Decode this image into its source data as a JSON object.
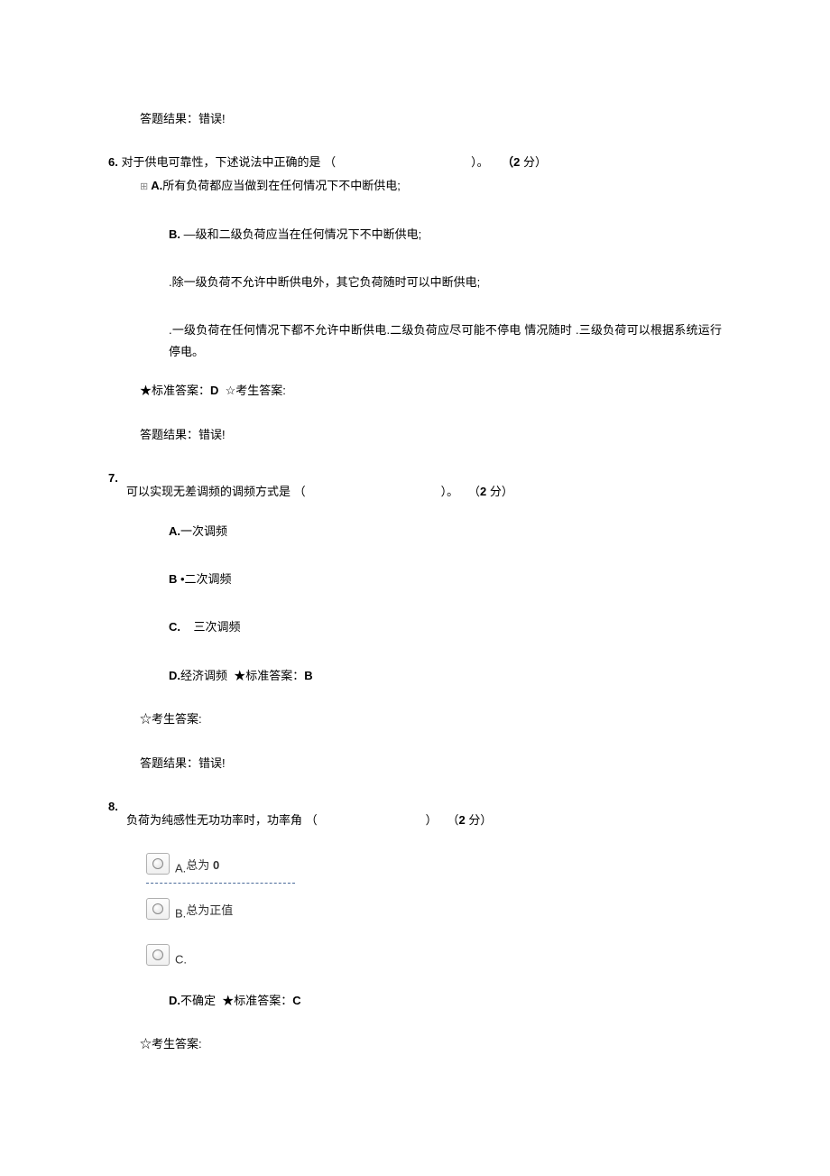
{
  "result_prefix": "答题结果：",
  "result_wrong": "错误!",
  "standard_answer_prefix": "★标准答案：",
  "student_answer_prefix": "☆考生答案:",
  "score_open": "（",
  "score_close": " 分）",
  "paren_open": "（",
  "paren_close": "）。",
  "paren_close_nodot": "）",
  "dot_sep": "。",
  "q6": {
    "num": "6.",
    "stem": " 对于供电可靠性，下述说法中正确的是",
    "score": "2",
    "optA_label": "A.",
    "optA": "所有负荷都应当做到在任何情况下不中断供电;",
    "optB_label": "B.",
    "optB": "  —级和二级负荷应当在任何情况下不中断供电;",
    "optC": ".除一级负荷不允许中断供电外，其它负荷随时可以中断供电;",
    "optD": ".一级负荷在任何情况下都不允许中断供电.二级负荷应尽可能不停电 情况随时     .三级负荷可以根据系统运行停电。",
    "answer": "D"
  },
  "q7": {
    "num": "7.",
    "stem": "可以实现无差调频的调频方式是",
    "score": "2",
    "optA_label": "A.",
    "optA": "一次调频",
    "optB_label": "B",
    "optB": " •二次调频",
    "optC_label": "C.",
    "optC": "三次调频",
    "optD_label": "D.",
    "optD": "经济调频",
    "answer": "B"
  },
  "q8": {
    "num": "8.",
    "stem": "负荷为纯感性无功功率时，功率角",
    "score": "2",
    "optA_label": "A.",
    "optA": "总为",
    "optA_val": "0",
    "optB_label": "B.",
    "optB": "总为正值",
    "optC_label": "C.",
    "optD_label": "D.",
    "optD": "不确定",
    "answer": "C"
  }
}
